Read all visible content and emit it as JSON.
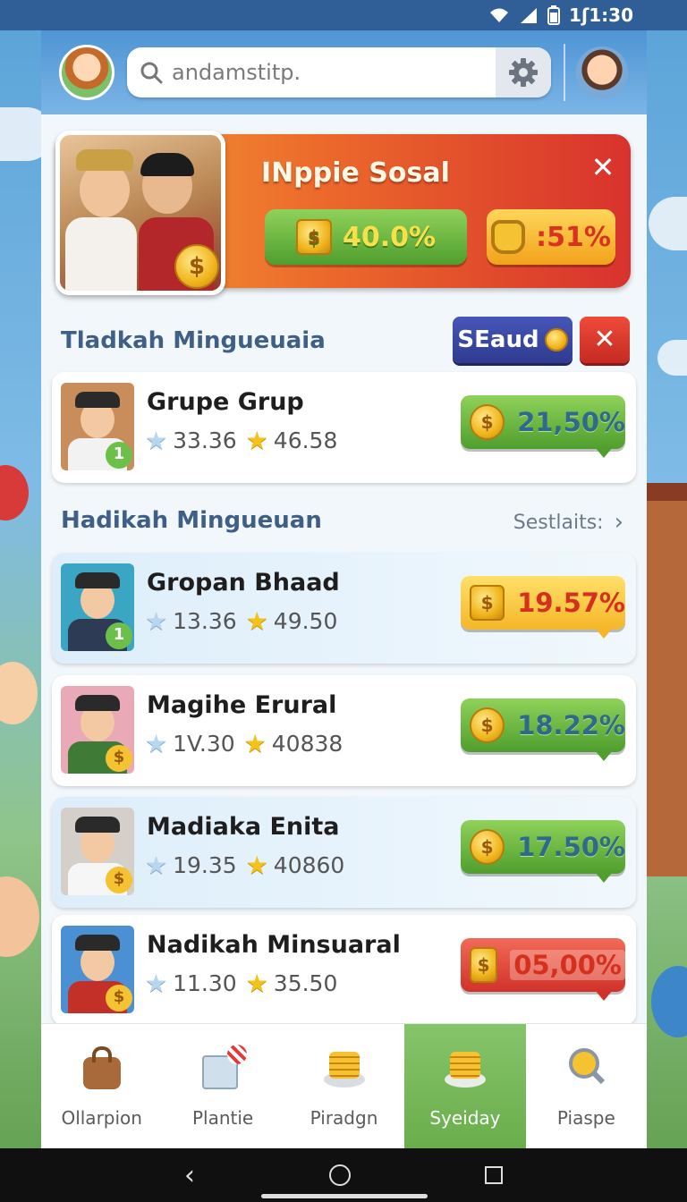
{
  "status_bar": {
    "time": "1ʃ1:30"
  },
  "search": {
    "text": "andamstitp."
  },
  "banner": {
    "title": "INppie Sosal",
    "green_value": "40.0%",
    "yellow_value": ":51%"
  },
  "section1": {
    "title": "Tladkah Minguеuaia",
    "sound_button": "SEaud",
    "items": [
      {
        "name": "Grupe Grup",
        "stat1": "33.36",
        "stat2": "46.58",
        "rate": "21,50%",
        "style": "green",
        "badge": "1"
      }
    ]
  },
  "section2": {
    "title": "Hadikah Mingueuan",
    "see_all": "Sestlaits:",
    "items": [
      {
        "name": "Gropan Bhaad",
        "stat1": "13.36",
        "stat2": "49.50",
        "rate": "19.57%",
        "style": "yellow",
        "badge": "1"
      },
      {
        "name": "Magihe Erural",
        "stat1": "1V.30",
        "stat2": "40838",
        "rate": "18.22%",
        "style": "green",
        "badge": "$"
      },
      {
        "name": "Madiaka Enita",
        "stat1": "19.35",
        "stat2": "40860",
        "rate": "17.50%",
        "style": "green",
        "badge": "$"
      },
      {
        "name": "Nadikah Minsuaral",
        "stat1": "11.30",
        "stat2": "35.50",
        "rate": "05,00%",
        "style": "red",
        "badge": "$"
      }
    ]
  },
  "bottom_nav": [
    {
      "label": "Ollarpion",
      "icon": "bag-icon"
    },
    {
      "label": "Plantie",
      "icon": "box-icon"
    },
    {
      "label": "Piradgn",
      "icon": "coin-stack-icon"
    },
    {
      "label": "Syeiday",
      "icon": "coin-stack-icon",
      "active": true
    },
    {
      "label": "Piaspe",
      "icon": "magnifier-coin-icon"
    }
  ],
  "colors": {
    "accent_green": "#6aae4c",
    "banner_orange": "#ec6b2b",
    "accent_blue": "#2e3b8f",
    "alert_red": "#d0322a"
  }
}
